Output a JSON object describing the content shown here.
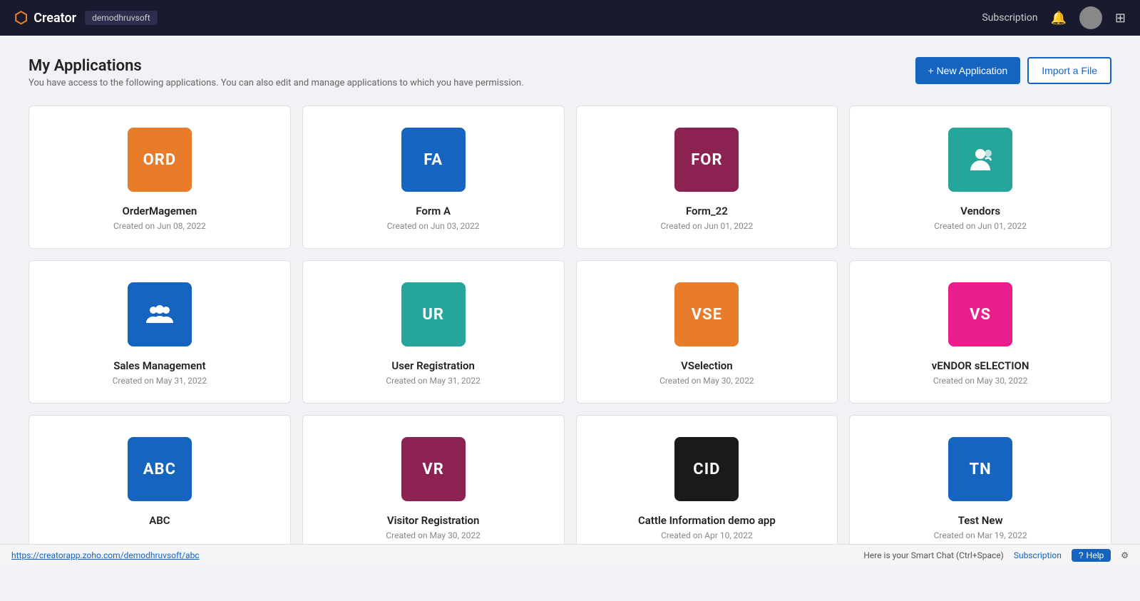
{
  "topnav": {
    "logo_text": "Creator",
    "badge_text": "demodhruvsoft",
    "subscription_label": "Subscription",
    "url": "https://creatorapp.zoho.com/demodhruvsoft/abc"
  },
  "page_header": {
    "title": "My Applications",
    "subtitle": "You have access to the following applications. You can also edit and manage applications to which you have permission.",
    "new_app_label": "+ New Application",
    "import_label": "Import a File"
  },
  "apps": [
    {
      "id": "order-mgmt",
      "abbr": "ORD",
      "color": "#e87c2a",
      "name": "OrderMagemen",
      "date": "Created on Jun 08, 2022",
      "icon_type": "text"
    },
    {
      "id": "form-a",
      "abbr": "FA",
      "color": "#1565c0",
      "name": "Form A",
      "date": "Created on Jun 03, 2022",
      "icon_type": "text"
    },
    {
      "id": "form-22",
      "abbr": "FOR",
      "color": "#8b2252",
      "name": "Form_22",
      "date": "Created on Jun 01, 2022",
      "icon_type": "text"
    },
    {
      "id": "vendors",
      "abbr": "",
      "color": "#26a69a",
      "name": "Vendors",
      "date": "Created on Jun 01, 2022",
      "icon_type": "vendor-icon"
    },
    {
      "id": "sales-mgmt",
      "abbr": "",
      "color": "#1565c0",
      "name": "Sales Management",
      "date": "Created on May 31, 2022",
      "icon_type": "users-icon"
    },
    {
      "id": "user-reg",
      "abbr": "UR",
      "color": "#26a69a",
      "name": "User Registration",
      "date": "Created on May 31, 2022",
      "icon_type": "text"
    },
    {
      "id": "vselection",
      "abbr": "VSE",
      "color": "#e87c2a",
      "name": "VSelection",
      "date": "Created on May 30, 2022",
      "icon_type": "text"
    },
    {
      "id": "vendor-sel",
      "abbr": "VS",
      "color": "#e91e8c",
      "name": "vENDOR sELECTION",
      "date": "Created on May 30, 2022",
      "icon_type": "text"
    },
    {
      "id": "abc",
      "abbr": "ABC",
      "color": "#1565c0",
      "name": "ABC",
      "date": "",
      "icon_type": "text"
    },
    {
      "id": "visitor-reg",
      "abbr": "VR",
      "color": "#8b2252",
      "name": "Visitor Registration",
      "date": "Created on May 30, 2022",
      "icon_type": "text"
    },
    {
      "id": "cattle-info",
      "abbr": "CID",
      "color": "#1a1a1a",
      "name": "Cattle Information demo app",
      "date": "Created on Apr 10, 2022",
      "icon_type": "text"
    },
    {
      "id": "test-new",
      "abbr": "TN",
      "color": "#1565c0",
      "name": "Test New",
      "date": "Created on Mar 19, 2022",
      "icon_type": "text"
    }
  ],
  "statusbar": {
    "url": "https://creatorapp.zoho.com/demodhruvsoft/abc",
    "smart_chat": "Here is your Smart Chat (Ctrl+Space)",
    "subscription": "Subscription",
    "help": "Help"
  }
}
